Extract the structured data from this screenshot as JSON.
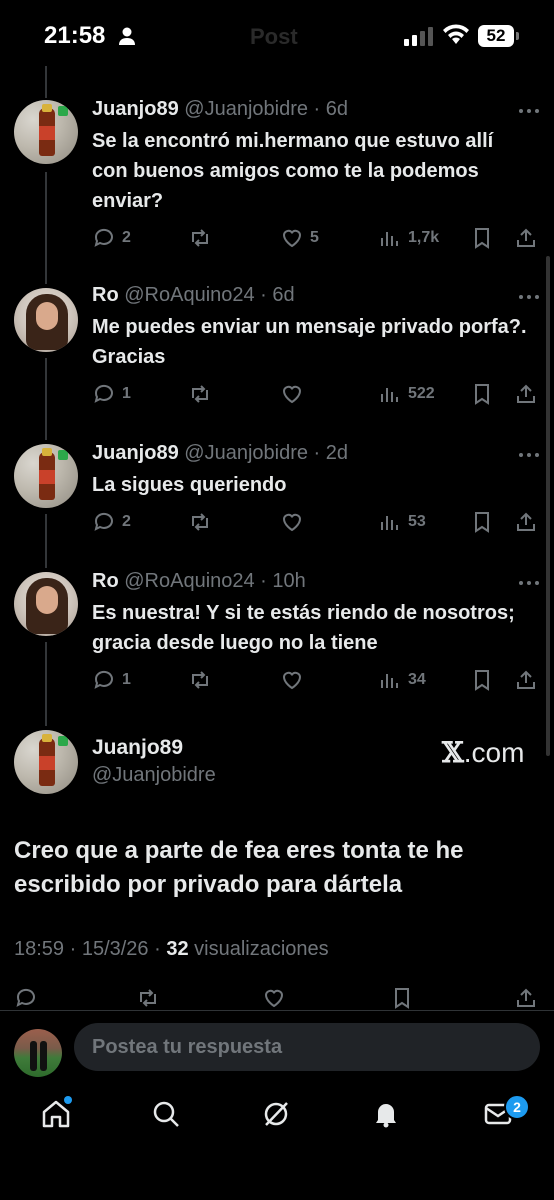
{
  "status_bar": {
    "time": "21:58",
    "title": "Post",
    "battery": "52"
  },
  "replies": [
    {
      "name": "Juanjo89",
      "handle": "@Juanjobidre",
      "age": "6d",
      "text": "Se la encontró mi.hermano que estuvo allí con buenos amigos como te la podemos enviar?",
      "replies": "2",
      "reposts": "",
      "likes": "5",
      "views": "1,7k"
    },
    {
      "name": "Ro",
      "handle": "@RoAquino24",
      "age": "6d",
      "text": "Me puedes enviar un mensaje privado porfa?. Gracias",
      "replies": "1",
      "reposts": "",
      "likes": "",
      "views": "522"
    },
    {
      "name": "Juanjo89",
      "handle": "@Juanjobidre",
      "age": "2d",
      "text": "La sigues queriendo",
      "replies": "2",
      "reposts": "",
      "likes": "",
      "views": "53"
    },
    {
      "name": "Ro",
      "handle": "@RoAquino24",
      "age": "10h",
      "text": "Es nuestra! Y si te estás riendo de nosotros; gracia desde luego no la tiene",
      "replies": "1",
      "reposts": "",
      "likes": "",
      "views": "34"
    }
  ],
  "main_post": {
    "name": "Juanjo89",
    "handle": "@Juanjobidre",
    "source": ".com",
    "text": "Creo que a parte de fea eres tonta te he escribido por privado para dártela",
    "timestamp": "18:59 · 15/3/26 ·",
    "views_count": "32",
    "views_label": "visualizaciones"
  },
  "composer": {
    "placeholder": "Postea tu respuesta"
  },
  "tabbar": {
    "messages_badge": "2"
  },
  "colors": {
    "accent": "#1d9bf0",
    "muted": "#71767b",
    "text": "#e7e9ea",
    "background": "#000000"
  }
}
